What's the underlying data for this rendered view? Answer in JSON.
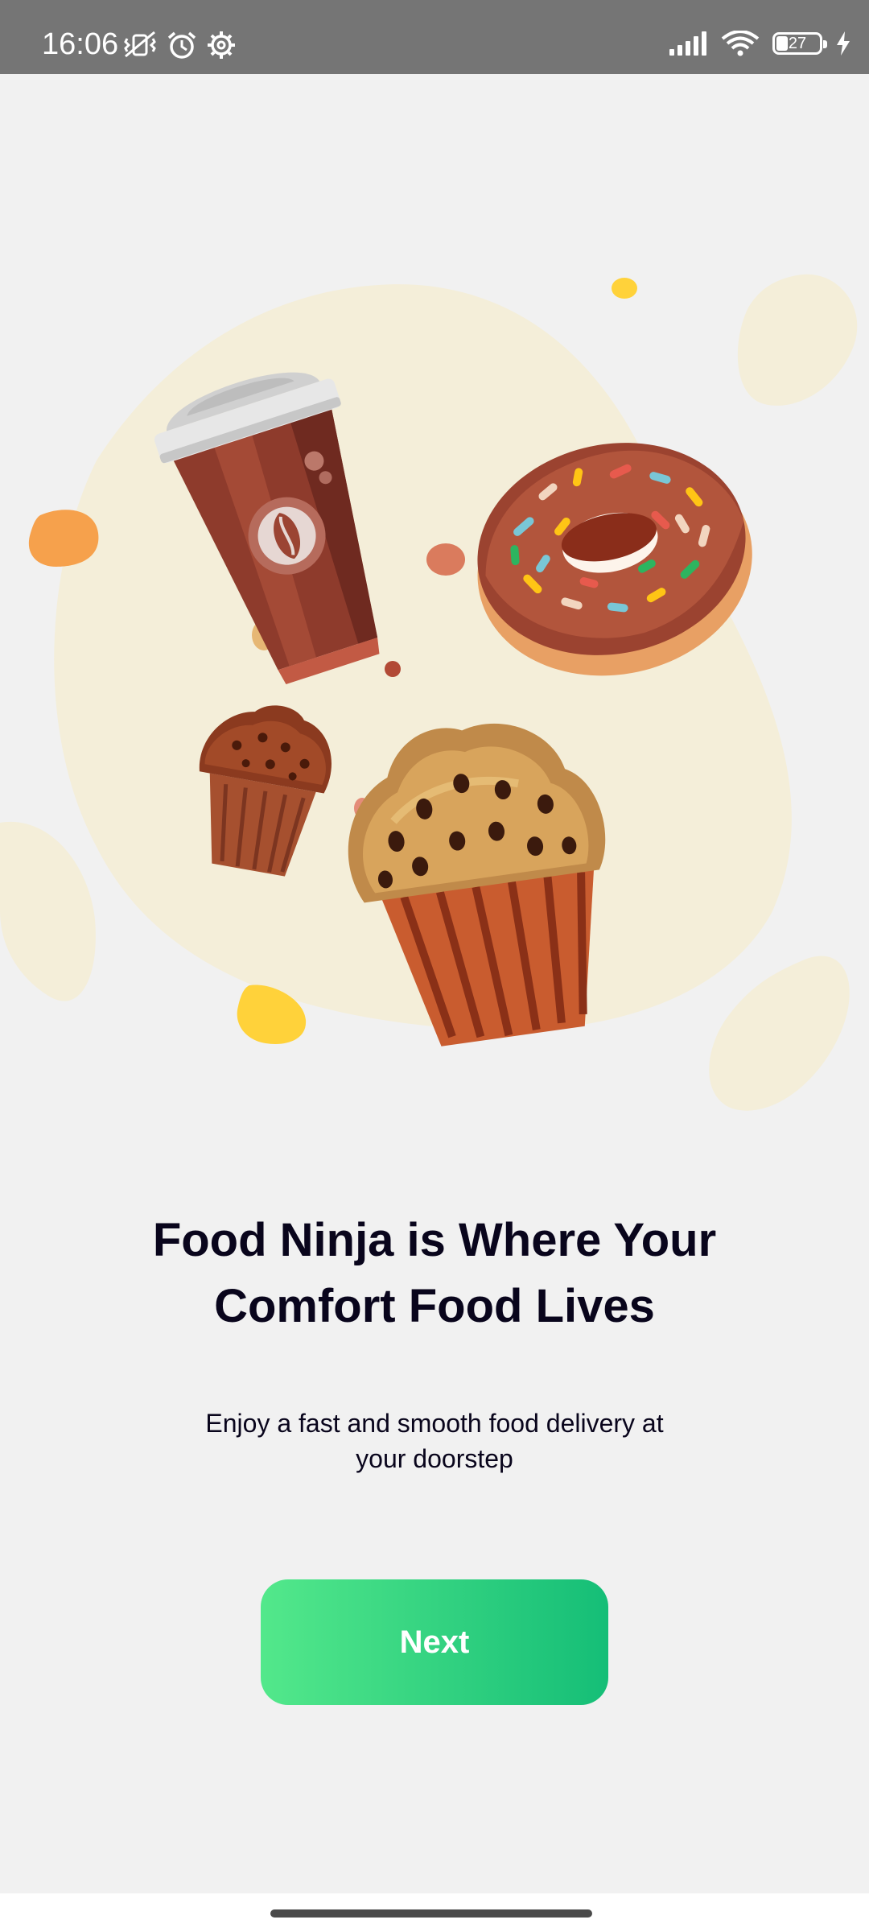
{
  "status_bar": {
    "time": "16:06",
    "battery_level": "27",
    "left_icons": [
      "vibrate-mute-icon",
      "alarm-icon",
      "settings-gear-icon"
    ],
    "right_icons": [
      "signal-icon",
      "wifi-icon",
      "battery-icon",
      "charging-icon"
    ]
  },
  "onboarding": {
    "headline": "Food Ninja is Where Your Comfort Food Lives",
    "subtitle": "Enjoy a fast and smooth food delivery at your doorstep",
    "next_label": "Next"
  },
  "illustration": {
    "items": [
      "coffee-cup",
      "donut",
      "small-muffin",
      "large-muffin"
    ]
  },
  "colors": {
    "button_gradient_start": "#53e88b",
    "button_gradient_end": "#15be77",
    "background": "#f1f1f1",
    "blob": "#f4eed9",
    "status_bar": "#757575"
  }
}
